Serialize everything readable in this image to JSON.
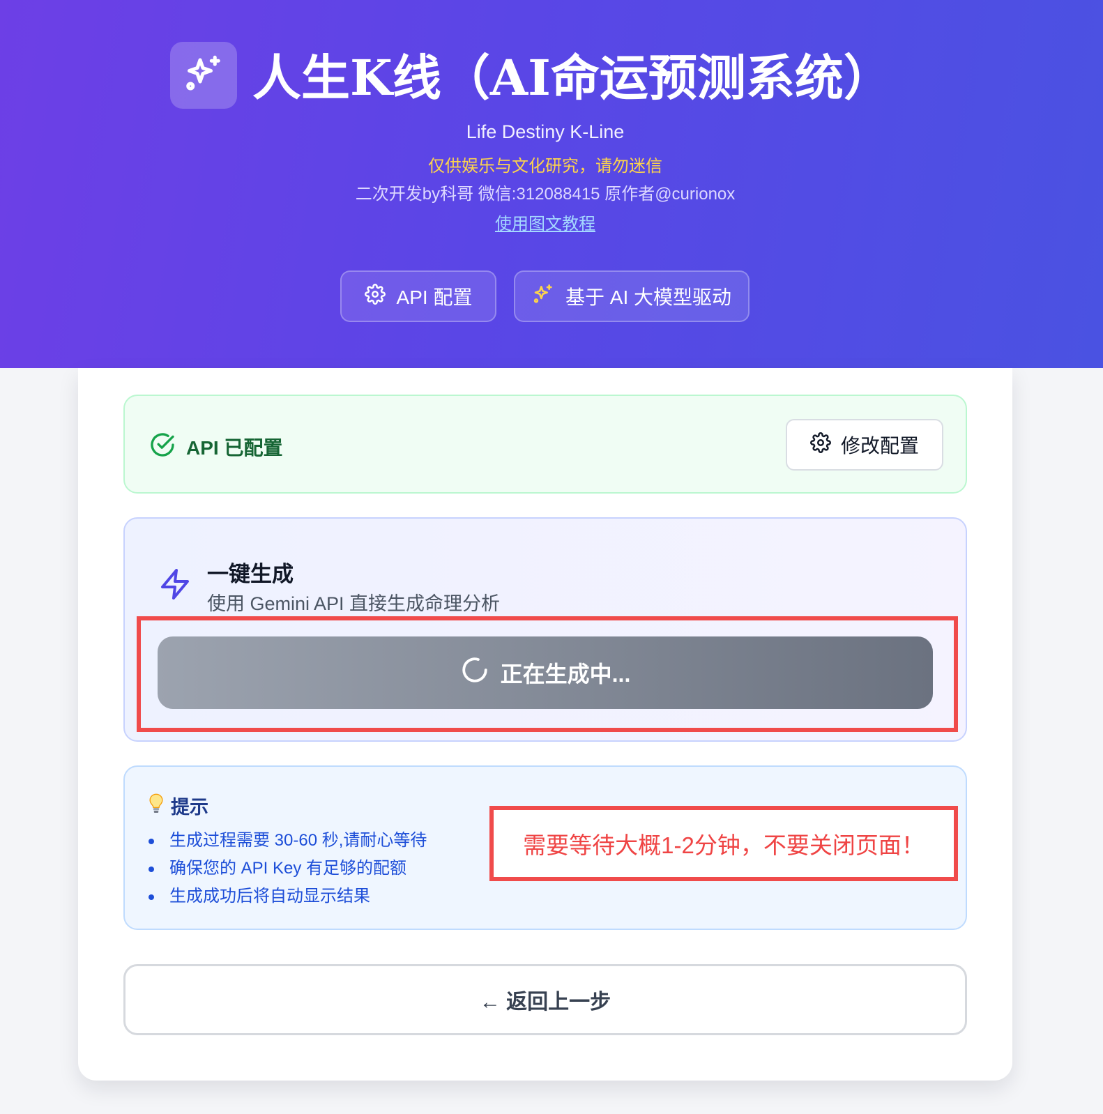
{
  "header": {
    "title": "人生K线（AI命运预测系统）",
    "subtitle_en": "Life Destiny K-Line",
    "disclaimer": "仅供娱乐与文化研究，请勿迷信",
    "credit": "二次开发by科哥 微信:312088415 原作者@curionox",
    "tutorial_link": "使用图文教程",
    "buttons": {
      "api_config": "API 配置",
      "ai_driven": "基于 AI 大模型驱动"
    }
  },
  "api_status": {
    "text": "API 已配置",
    "modify_button": "修改配置"
  },
  "generate": {
    "title": "一键生成",
    "description": "使用 Gemini API 直接生成命理分析",
    "button_loading": "正在生成中..."
  },
  "tips": {
    "title": "提示",
    "items": [
      "生成过程需要 30-60 秒,请耐心等待",
      "确保您的 API Key 有足够的配额",
      "生成成功后将自动显示结果"
    ]
  },
  "annotation": {
    "warning": "需要等待大概1-2分钟，不要关闭页面！"
  },
  "back_button": "← 返回上一步",
  "icons": {
    "logo": "sparkles-icon",
    "api_config": "gear-icon",
    "ai_driven": "sparkles-icon",
    "status": "check-circle-icon",
    "modify": "gear-icon",
    "generate": "lightning-bolt-icon",
    "loading": "spinner-icon",
    "tips": "lightbulb-icon"
  },
  "colors": {
    "header_gradient_start": "#6d3fe6",
    "header_gradient_end": "#4a52e2",
    "disclaimer": "#fcd34d",
    "success": "#16a34a",
    "accent": "#4f46e5",
    "tips_text": "#1d4ed8",
    "annotation_red": "#ef4444"
  }
}
